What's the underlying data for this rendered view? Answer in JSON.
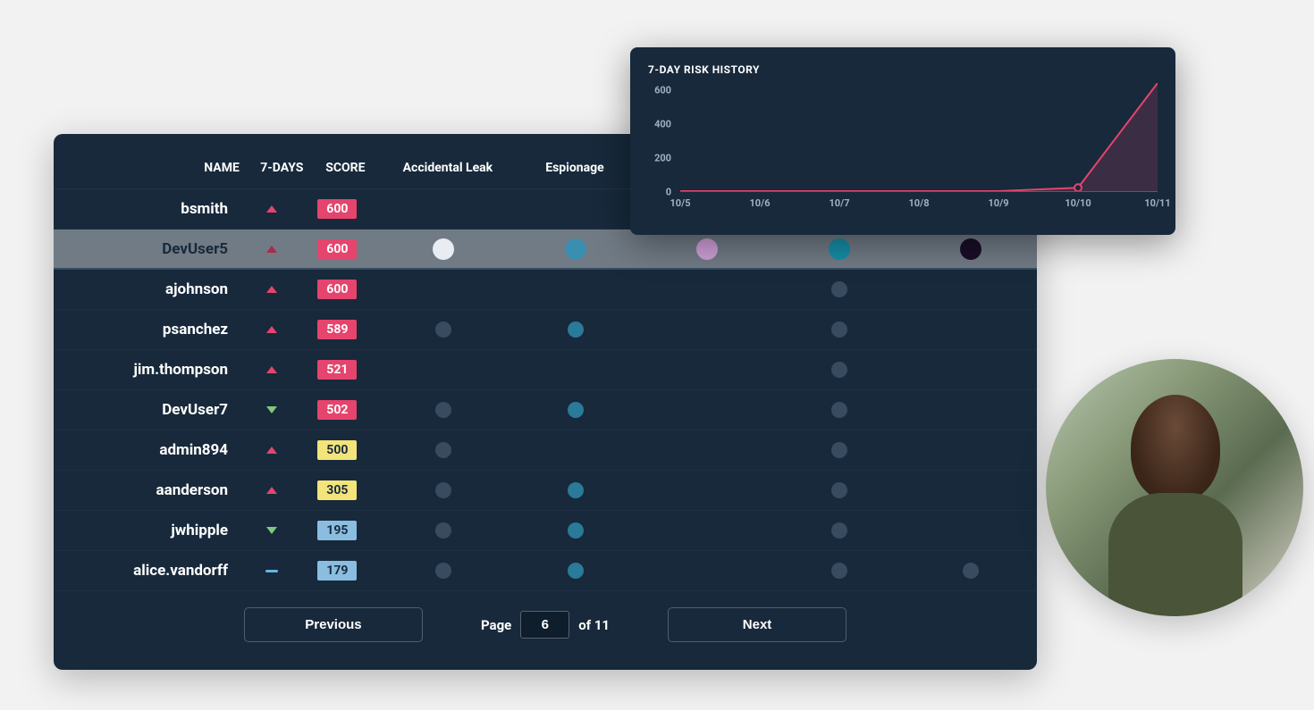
{
  "table": {
    "headers": {
      "name": "NAME",
      "days7": "7-DAYS",
      "score": "SCORE",
      "cat1": "Accidental Leak",
      "cat2": "Espionage"
    },
    "rows": [
      {
        "name": "bsmith",
        "trend": "up",
        "score": "600",
        "badge": "red",
        "selected": false,
        "dots": [
          null,
          null,
          null,
          "dim",
          null
        ]
      },
      {
        "name": "DevUser5",
        "trend": "up-dark",
        "score": "600",
        "badge": "red",
        "selected": true,
        "dots": [
          "white",
          "bluemed",
          "pink",
          "teal",
          "darkpurple"
        ]
      },
      {
        "name": "ajohnson",
        "trend": "up",
        "score": "600",
        "badge": "red",
        "selected": false,
        "dots": [
          null,
          null,
          null,
          "dim",
          null
        ]
      },
      {
        "name": "psanchez",
        "trend": "up",
        "score": "589",
        "badge": "red",
        "selected": false,
        "dots": [
          "dim",
          "blue",
          null,
          "dim",
          null
        ]
      },
      {
        "name": "jim.thompson",
        "trend": "up",
        "score": "521",
        "badge": "red",
        "selected": false,
        "dots": [
          null,
          null,
          null,
          "dim",
          null
        ]
      },
      {
        "name": "DevUser7",
        "trend": "down",
        "score": "502",
        "badge": "red",
        "selected": false,
        "dots": [
          "dim",
          "blue",
          null,
          "dim",
          null
        ]
      },
      {
        "name": "admin894",
        "trend": "up",
        "score": "500",
        "badge": "yellow",
        "selected": false,
        "dots": [
          "dim",
          null,
          null,
          "dim",
          null
        ]
      },
      {
        "name": "aanderson",
        "trend": "up",
        "score": "305",
        "badge": "yellow",
        "selected": false,
        "dots": [
          "dim",
          "blue",
          null,
          "dim",
          null
        ]
      },
      {
        "name": "jwhipple",
        "trend": "down",
        "score": "195",
        "badge": "blue",
        "selected": false,
        "dots": [
          "dim",
          "blue",
          null,
          "dim",
          null
        ]
      },
      {
        "name": "alice.vandorff",
        "trend": "flat",
        "score": "179",
        "badge": "blue",
        "selected": false,
        "dots": [
          "dim",
          "blue",
          null,
          "dim",
          "dim"
        ]
      }
    ]
  },
  "pagination": {
    "prev_label": "Previous",
    "next_label": "Next",
    "page_label": "Page",
    "of_label": "of 11",
    "current": "6"
  },
  "chart": {
    "title": "7-DAY RISK HISTORY"
  },
  "chart_data": {
    "type": "line",
    "x": [
      "10/5",
      "10/6",
      "10/7",
      "10/8",
      "10/9",
      "10/10",
      "10/11"
    ],
    "values": [
      0,
      0,
      0,
      0,
      0,
      20,
      640
    ],
    "ylim": [
      0,
      640
    ],
    "yticks": [
      0,
      200,
      400,
      600
    ],
    "xlabel": "",
    "ylabel": "",
    "title": "7-DAY RISK HISTORY"
  }
}
